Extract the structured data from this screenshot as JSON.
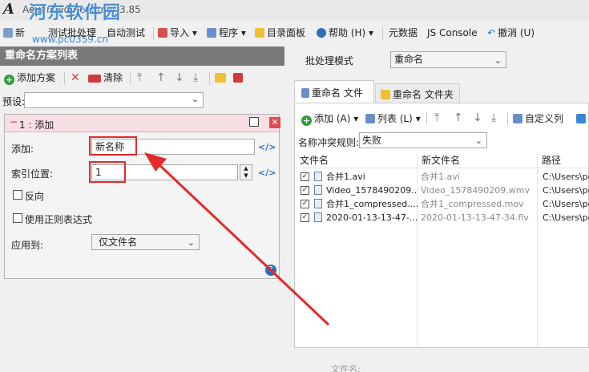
{
  "window": {
    "title": "Advanced Renamer 3.85"
  },
  "watermark": {
    "text": "河东软件园",
    "url": "www.pc0359.cn"
  },
  "menubar": {
    "left_partial": "新",
    "test_batch": "测试批处理",
    "auto_test": "自动测试",
    "import": "导入",
    "programs": "程序",
    "directory_panel": "目录面板",
    "help": "帮助 (H)",
    "metadata": "元数据",
    "js_console": "JS Console",
    "undo": "撤消 (U)"
  },
  "left_panel": {
    "header": "重命名方案列表",
    "add_method": "添加方案",
    "clear": "清除",
    "preset_label": "预设:",
    "preset_value": ""
  },
  "method": {
    "title": "1 : 添加",
    "add_label": "添加:",
    "add_value": "新名称",
    "index_label": "索引位置:",
    "index_value": "1",
    "reverse_label": "反向",
    "regex_label": "使用正则表达式",
    "apply_label": "应用到:",
    "apply_value": "仅文件名"
  },
  "right_panel": {
    "batch_mode_label": "批处理模式",
    "batch_mode_value": "重命名",
    "tab_files": "重命名 文件",
    "tab_folders": "重命名 文件夹",
    "add_btn": "添加 (A)",
    "list_btn": "列表 (L)",
    "custom_cols": "自定义列",
    "conflict_label": "名称冲突规则:",
    "conflict_value": "失败",
    "columns": {
      "filename": "文件名",
      "newname": "新文件名",
      "path": "路径"
    },
    "rows": [
      {
        "checked": true,
        "name": "合并1.avi",
        "new": "合并1.avi",
        "path": "C:\\Users\\pc\\"
      },
      {
        "checked": true,
        "name": "Video_1578490209....",
        "new": "Video_1578490209.wmv",
        "path": "C:\\Users\\pc\\"
      },
      {
        "checked": true,
        "name": "合并1_compressed....",
        "new": "合并1_compressed.mov",
        "path": "C:\\Users\\pc\\"
      },
      {
        "checked": true,
        "name": "2020-01-13-13-47-...",
        "new": "2020-01-13-13-47-34.flv",
        "path": "C:\\Users\\pc\\"
      }
    ],
    "footer_label": "文件名:"
  },
  "colors": {
    "header_bg": "#7a7a7a",
    "method_head_bg": "#f8dfe4",
    "annotation_red": "#e52a2a",
    "accent_blue": "#3a86d6"
  }
}
